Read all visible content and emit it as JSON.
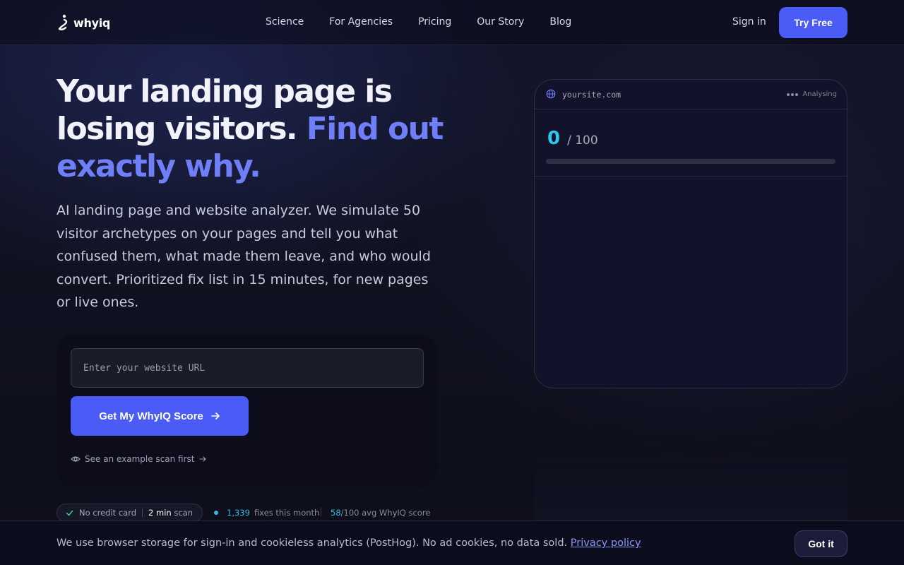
{
  "brand": {
    "name": "whyiq"
  },
  "nav": {
    "links": [
      "Science",
      "For Agencies",
      "Pricing",
      "Our Story",
      "Blog"
    ],
    "signin": "Sign in",
    "try_free": "Try Free"
  },
  "hero": {
    "title_line1": "Your landing page is",
    "title_line2": "losing visitors.",
    "title_accent1": "Find",
    "title_accent2": "out exactly why.",
    "subtitle": "AI landing page and website analyzer. We simulate 50 visitor archetypes on your pages and tell you what confused them, what made them leave, and who would convert. Prioritized fix list in 15 minutes, for new pages or live ones."
  },
  "form": {
    "url_placeholder": "Enter your website URL",
    "url_value": "",
    "cta_label": "Get My WhyIQ Score",
    "example_link": "See an example scan first"
  },
  "badges": {
    "no_credit_card": "No credit card",
    "time_bold": "2 min",
    "time_rest": "scan",
    "fixes_num": "1,339",
    "fixes_label": "fixes this month",
    "avg_num": "58",
    "avg_label": "/100 avg WhyIQ score"
  },
  "preview": {
    "url": "yoursite.com",
    "status": "Analysing",
    "score": "0",
    "score_max": "/ 100",
    "progress": 0
  },
  "cookie": {
    "text": "We use browser storage for sign-in and cookieless analytics (PostHog). No ad cookies, no data sold.",
    "link": "Privacy policy",
    "button": "Got it"
  },
  "colors": {
    "accent": "#4a5cf5",
    "accent_text": "#6f7ff7",
    "score": "#30c6ee"
  }
}
